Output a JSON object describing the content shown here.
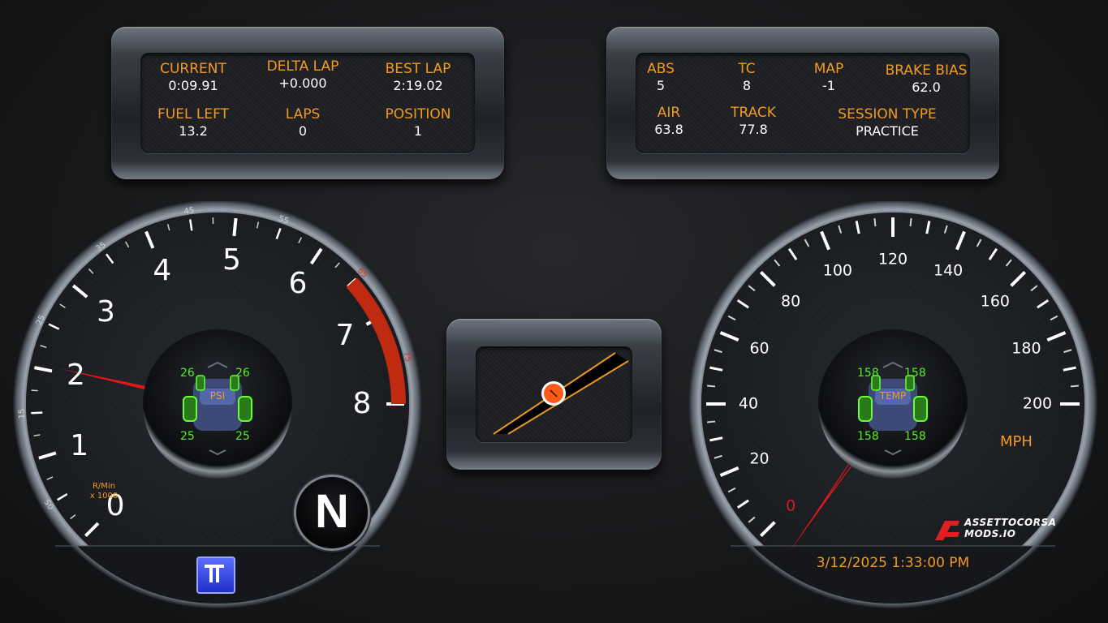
{
  "timing": {
    "current_label": "CURRENT",
    "current_value": "0:09.91",
    "delta_label": "DELTA LAP",
    "delta_value": "+0.000",
    "best_label": "BEST LAP",
    "best_value": "2:19.02",
    "fuel_label": "FUEL LEFT",
    "fuel_value": "13.2",
    "laps_label": "LAPS",
    "laps_value": "0",
    "position_label": "POSITION",
    "position_value": "1"
  },
  "car": {
    "abs_label": "ABS",
    "abs_value": "5",
    "tc_label": "TC",
    "tc_value": "8",
    "map_label": "MAP",
    "map_value": "-1",
    "brake_label": "BRAKE BIAS",
    "brake_value": "62.0",
    "air_label": "AIR",
    "air_value": "63.8",
    "track_label": "TRACK",
    "track_value": "77.8",
    "session_label": "SESSION TYPE",
    "session_value": "PRACTICE"
  },
  "tach": {
    "major_labels": [
      "0",
      "1",
      "2",
      "3",
      "4",
      "5",
      "6",
      "7",
      "8"
    ],
    "minor_labels": [
      "05",
      "15",
      "25",
      "35",
      "45",
      "55",
      "65",
      "75"
    ],
    "unit_line1": "R/Min",
    "unit_line2": "x 1000",
    "rpm_value": 2.05,
    "redline_start": 6.5,
    "gear": "N"
  },
  "tires_psi": {
    "fl": "26",
    "fr": "26",
    "rl": "25",
    "rr": "25",
    "label": "PSI"
  },
  "tires_temp": {
    "fl": "158",
    "fr": "158",
    "rl": "158",
    "rr": "158",
    "label": "TEMP"
  },
  "speedo": {
    "labels": [
      "0",
      "20",
      "40",
      "60",
      "80",
      "100",
      "120",
      "140",
      "160",
      "180",
      "200"
    ],
    "unit": "MPH",
    "speed_value": 0,
    "datetime": "3/12/2025 1:33:00 PM"
  },
  "brand": {
    "line1": "ASSETTOCORSA",
    "line2": "MODS.IO"
  },
  "colors": {
    "accent": "#f39a1e",
    "tire_green": "#55ee22",
    "needle_red": "#e01818",
    "redline": "#c02a10"
  }
}
